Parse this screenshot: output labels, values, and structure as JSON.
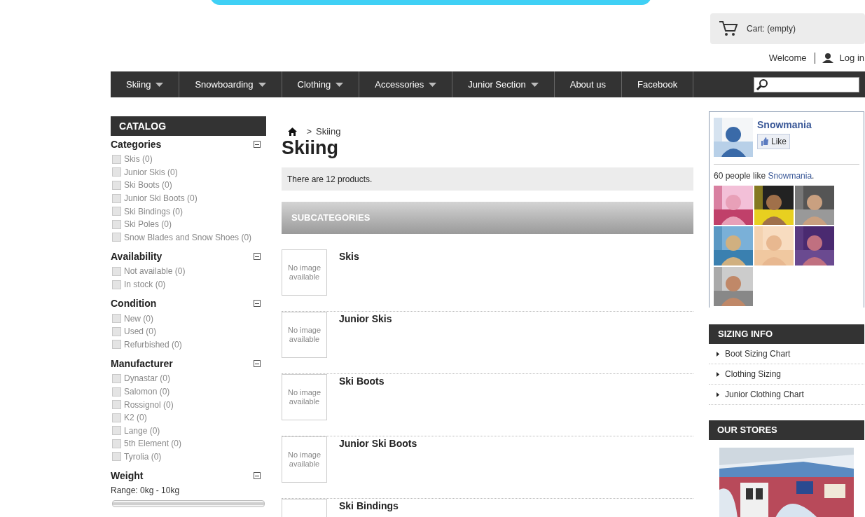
{
  "header": {
    "cart": "Cart: (empty)",
    "welcome": "Welcome",
    "login": "Log in"
  },
  "nav": [
    {
      "label": "Skiing",
      "has_menu": true
    },
    {
      "label": "Snowboarding",
      "has_menu": true
    },
    {
      "label": "Clothing",
      "has_menu": true
    },
    {
      "label": "Accessories",
      "has_menu": true
    },
    {
      "label": "Junior Section",
      "has_menu": true
    },
    {
      "label": "About us",
      "has_menu": false
    },
    {
      "label": "Facebook",
      "has_menu": false
    }
  ],
  "catalog": {
    "title": "CATALOG",
    "groups": [
      {
        "title": "Categories",
        "expanded": true,
        "options": [
          {
            "label": "Skis (0)",
            "checked": false
          },
          {
            "label": "Junior Skis (0)",
            "checked": false
          },
          {
            "label": "Ski Boots (0)",
            "checked": false
          },
          {
            "label": "Junior Ski Boots (0)",
            "checked": false
          },
          {
            "label": "Ski Bindings (0)",
            "checked": false
          },
          {
            "label": "Ski Poles (0)",
            "checked": false
          },
          {
            "label": "Snow Blades and Snow Shoes (0)",
            "checked": false
          }
        ]
      },
      {
        "title": "Availability",
        "expanded": true,
        "options": [
          {
            "label": "Not available (0)",
            "checked": false
          },
          {
            "label": "In stock (0)",
            "checked": false
          }
        ]
      },
      {
        "title": "Condition",
        "expanded": true,
        "options": [
          {
            "label": "New (0)",
            "checked": false
          },
          {
            "label": "Used (0)",
            "checked": false
          },
          {
            "label": "Refurbished (0)",
            "checked": false
          }
        ]
      },
      {
        "title": "Manufacturer",
        "expanded": true,
        "options": [
          {
            "label": "Dynastar (0)",
            "checked": false
          },
          {
            "label": "Salomon (0)",
            "checked": false
          },
          {
            "label": "Rossignol (0)",
            "checked": false
          },
          {
            "label": "K2 (0)",
            "checked": false
          },
          {
            "label": "Lange (0)",
            "checked": false
          },
          {
            "label": "5th Element (0)",
            "checked": false
          },
          {
            "label": "Tyrolia (0)",
            "checked": false
          }
        ]
      },
      {
        "title": "Weight",
        "expanded": true,
        "range": "Range: 0kg - 10kg",
        "level": 1
      }
    ]
  },
  "breadcrumb": {
    "current": "Skiing",
    "separator": ">"
  },
  "page_title": "Skiing",
  "product_count": "There are 12 products.",
  "subcategories": {
    "title": "SUBCATEGORIES",
    "items": [
      {
        "name": "Skis",
        "image_text": "No image available"
      },
      {
        "name": "Junior Skis",
        "image_text": "No image available"
      },
      {
        "name": "Ski Boots",
        "image_text": "No image available"
      },
      {
        "name": "Junior Ski Boots",
        "image_text": "No image available"
      },
      {
        "name": "Ski Bindings"
      }
    ]
  },
  "facebook": {
    "page_name": "Snowmania",
    "like_button": "Like",
    "likes_text": "60 people like ",
    "likes_link": "Snowmania",
    "likes_end": "."
  },
  "sizing_info": {
    "title": "SIZING INFO",
    "links": [
      "Boot Sizing Chart",
      "Clothing Sizing",
      "Junior Clothing Chart"
    ]
  },
  "stores": {
    "title": "OUR STORES"
  }
}
